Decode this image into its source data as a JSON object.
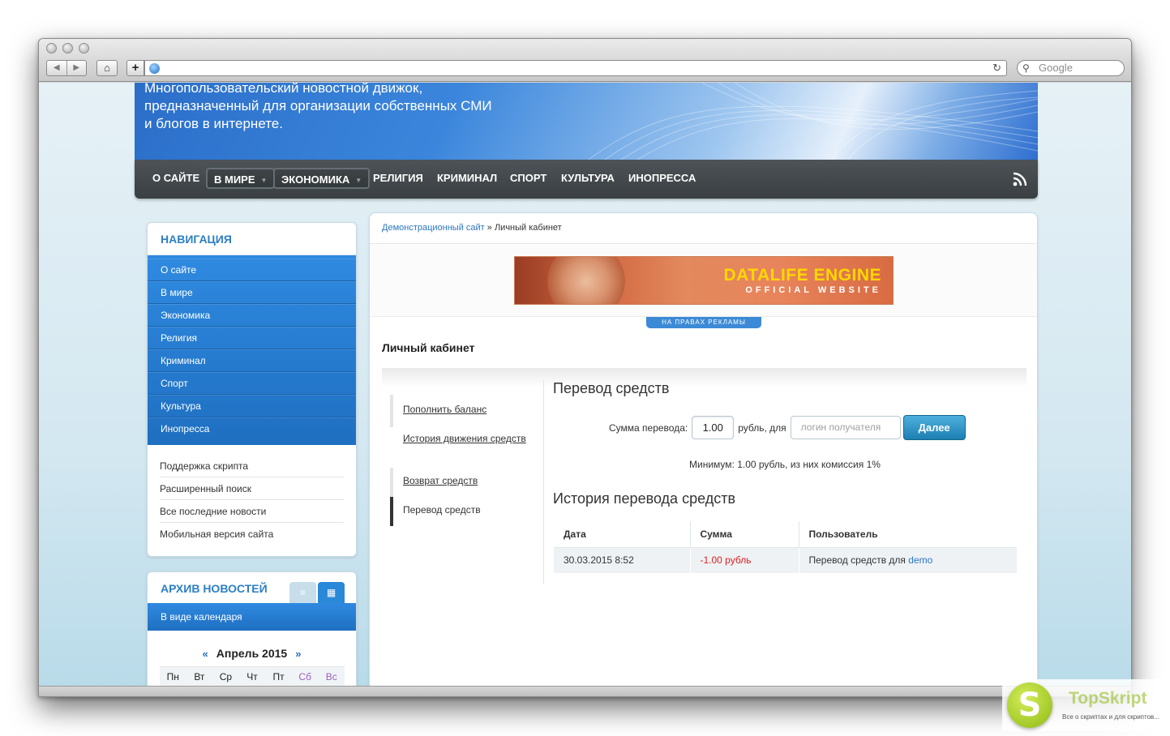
{
  "browser": {
    "back_glyph": "◀",
    "forward_glyph": "▶",
    "home_glyph": "⌂",
    "add_glyph": "+",
    "reload_glyph": "↻",
    "search_placeholder": "Google",
    "search_glyph": "⚲"
  },
  "header": {
    "tagline": "Многопользовательский новостной движок, предназначенный для организации собственных СМИ и блогов в интернете."
  },
  "topnav": {
    "items": [
      "О САЙТЕ",
      "В МИРЕ",
      "ЭКОНОМИКА",
      "РЕЛИГИЯ",
      "КРИМИНАЛ",
      "СПОРТ",
      "КУЛЬТУРА",
      "ИНОПРЕССА"
    ],
    "dropdown_caret": "▼"
  },
  "sidebar": {
    "nav_title": "НАВИГАЦИЯ",
    "blue_items": [
      "О сайте",
      "В мире",
      "Экономика",
      "Религия",
      "Криминал",
      "Спорт",
      "Культура",
      "Инопресса"
    ],
    "gray_items": [
      "Поддержка скрипта",
      "Расширенный поиск",
      "Все последние новости",
      "Мобильная версия сайта"
    ],
    "archive_title": "АРХИВ НОВОСТЕЙ",
    "archive_tab_list_glyph": "≡",
    "archive_tab_grid_glyph": "▦",
    "archive_bar": "В виде календаря",
    "calendar": {
      "prev": "«",
      "month": "Апрель 2015",
      "next": "»",
      "days": [
        "Пн",
        "Вт",
        "Ср",
        "Чт",
        "Пт",
        "Сб",
        "Вс"
      ]
    }
  },
  "breadcrumb": {
    "home": "Демонстрационный сайт",
    "sep": " » ",
    "current": "Личный кабинет"
  },
  "ad": {
    "title": "DATALIFE ENGINE",
    "subtitle": "OFFICIAL WEBSITE",
    "tag": "НА ПРАВАХ РЕКЛАМЫ"
  },
  "page": {
    "title": "Личный кабинет",
    "menu": [
      "Пополнить баланс",
      "История движения средств",
      "Возврат средств",
      "Перевод средств"
    ],
    "transfer": {
      "heading": "Перевод средств",
      "amount_label": "Сумма перевода:",
      "amount_value": "1.00",
      "unit_label": "рубль, для",
      "recipient_placeholder": "логин получателя",
      "submit": "Далее",
      "minimum_note": "Минимум: 1.00 рубль, из них комиссия 1%"
    },
    "history": {
      "heading": "История перевода средств",
      "columns": [
        "Дата",
        "Сумма",
        "Пользователь"
      ],
      "rows": [
        {
          "date": "30.03.2015 8:52",
          "amount": "-1.00 рубль",
          "user_text": "Перевод средств для ",
          "user_link": "demo"
        }
      ]
    }
  },
  "watermark": {
    "letter": "S",
    "name": "TopSkript",
    "tagline": "Все о скриптах и для скриптов..."
  },
  "colors": {
    "accent_blue": "#2d7fc3",
    "nav_dark": "#3a3f42",
    "negative": "#e02020",
    "link": "#2a76c2"
  }
}
